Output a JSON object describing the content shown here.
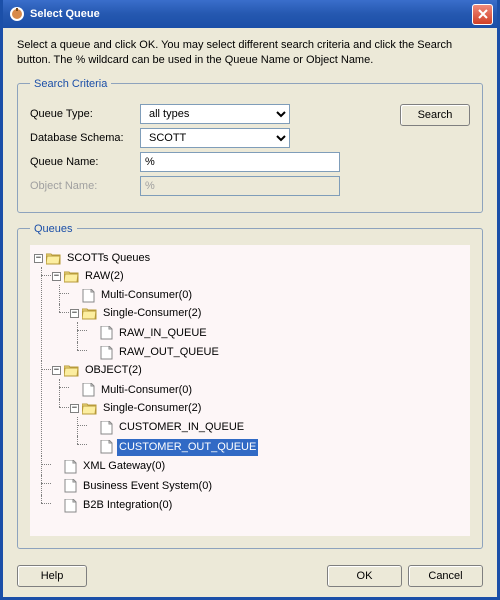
{
  "window": {
    "title": "Select Queue"
  },
  "instructions": "Select a queue and click OK. You may select different search criteria and click the Search button. The % wildcard can be used in the Queue Name or Object Name.",
  "criteria": {
    "legend": "Search Criteria",
    "queue_type_label": "Queue Type:",
    "queue_type_value": "all types",
    "db_schema_label": "Database Schema:",
    "db_schema_value": "SCOTT",
    "queue_name_label": "Queue Name:",
    "queue_name_value": "%",
    "object_name_label": "Object Name:",
    "object_name_value": "%",
    "search_button": "Search"
  },
  "queues": {
    "legend": "Queues",
    "root": "SCOTTs Queues",
    "raw": "RAW(2)",
    "raw_multi": "Multi-Consumer(0)",
    "raw_single": "Single-Consumer(2)",
    "raw_in": "RAW_IN_QUEUE",
    "raw_out": "RAW_OUT_QUEUE",
    "object": "OBJECT(2)",
    "obj_multi": "Multi-Consumer(0)",
    "obj_single": "Single-Consumer(2)",
    "cust_in": "CUSTOMER_IN_QUEUE",
    "cust_out": "CUSTOMER_OUT_QUEUE",
    "xml": "XML Gateway(0)",
    "bes": "Business Event System(0)",
    "b2b": "B2B Integration(0)"
  },
  "buttons": {
    "help": "Help",
    "ok": "OK",
    "cancel": "Cancel"
  },
  "colors": {
    "titlebar": "#1b4fa8",
    "selection": "#316ac5",
    "tree_bg": "#fdf6f7"
  }
}
